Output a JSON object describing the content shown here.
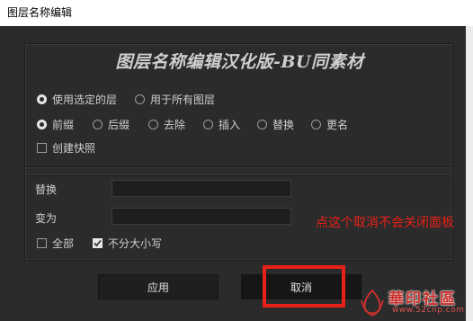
{
  "window": {
    "title": "图层名称编辑"
  },
  "panel1": {
    "header": "图层名称编辑汉化版-BU同素材",
    "scope_options": [
      {
        "label": "使用选定的层",
        "selected": true
      },
      {
        "label": "用于所有图层",
        "selected": false
      }
    ],
    "mode_options": [
      {
        "label": "前缀",
        "selected": true
      },
      {
        "label": "后缀",
        "selected": false
      },
      {
        "label": "去除",
        "selected": false
      },
      {
        "label": "插入",
        "selected": false
      },
      {
        "label": "替换",
        "selected": false
      },
      {
        "label": "更名",
        "selected": false
      }
    ],
    "create_snapshot": {
      "label": "创建快照",
      "checked": false
    }
  },
  "panel2": {
    "replace_label": "替换",
    "replace_value": "",
    "to_label": "变为",
    "to_value": "",
    "all_checkbox": {
      "label": "全部",
      "checked": false
    },
    "case_checkbox": {
      "label": "不分大小写",
      "checked": true
    }
  },
  "buttons": {
    "apply": "应用",
    "cancel": "取消"
  },
  "annotation": {
    "text": "点这个取消不会关闭面板",
    "color": "#e8201a"
  },
  "watermark": {
    "logo_text": "華印社區",
    "url_text": "www.52cnp.com"
  }
}
